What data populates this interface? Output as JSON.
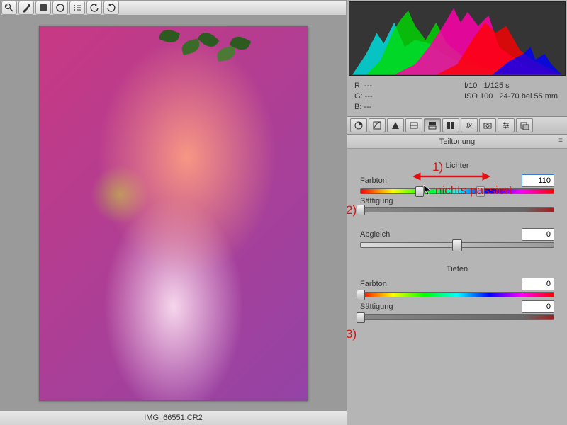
{
  "filename": "IMG_66551.CR2",
  "exif": {
    "r": "R:    ---",
    "g": "G:    ---",
    "b": "B:    ---",
    "aperture": "f/10",
    "shutter": "1/125 s",
    "iso": "ISO 100",
    "lens": "24-70 bei 55 mm"
  },
  "panel": {
    "title": "Teiltonung",
    "highlights_title": "Lichter",
    "shadows_title": "Tiefen",
    "hue_label": "Farbton",
    "sat_label": "Sättigung",
    "balance_label": "Abgleich",
    "highlights": {
      "hue": "110",
      "sat": "0"
    },
    "balance": {
      "value": "0"
    },
    "shadows": {
      "hue": "0",
      "sat": "0"
    }
  },
  "annotations": {
    "n1": "1)",
    "n2": "2)",
    "n3": "3)",
    "note": "nichts passiert"
  },
  "toolbar": {
    "tools": [
      "zoom",
      "brush",
      "square",
      "ellipse",
      "list",
      "rotate-ccw",
      "rotate-cw"
    ]
  },
  "tabs": {
    "items": [
      "aperture",
      "tone",
      "triangle",
      "rect",
      "grad",
      "split",
      "fx",
      "camera",
      "sliders",
      "overlap"
    ]
  }
}
